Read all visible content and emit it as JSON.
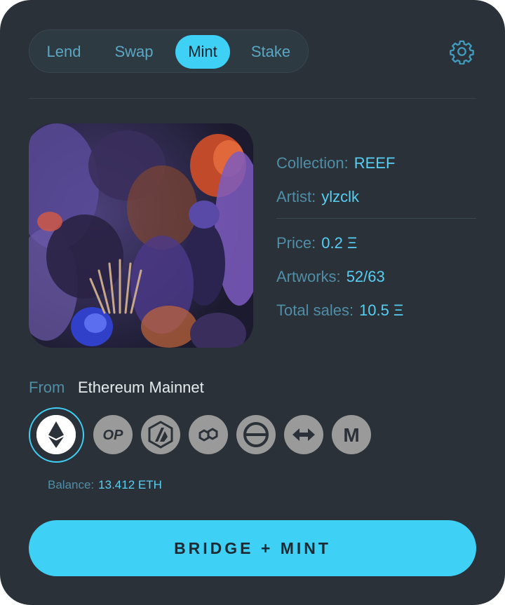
{
  "tabs": [
    {
      "label": "Lend",
      "active": false
    },
    {
      "label": "Swap",
      "active": false
    },
    {
      "label": "Mint",
      "active": true
    },
    {
      "label": "Stake",
      "active": false
    }
  ],
  "settings_icon": "gear-icon",
  "nft": {
    "collection_label": "Collection:",
    "collection_value": "REEF",
    "artist_label": "Artist:",
    "artist_value": "ylzclk",
    "price_label": "Price:",
    "price_value": "0.2 Ξ",
    "artworks_label": "Artworks:",
    "artworks_value": "52/63",
    "sales_label": "Total sales:",
    "sales_value": "10.5 Ξ"
  },
  "from": {
    "label": "From",
    "network": "Ethereum Mainnet"
  },
  "chains": [
    {
      "name": "ethereum-icon",
      "label": "",
      "selected": true
    },
    {
      "name": "optimism-icon",
      "label": "OP",
      "selected": false
    },
    {
      "name": "arbitrum-icon",
      "label": "",
      "selected": false
    },
    {
      "name": "polygon-icon",
      "label": "",
      "selected": false
    },
    {
      "name": "zksync-icon",
      "label": "",
      "selected": false
    },
    {
      "name": "bridge-arrows-icon",
      "label": "",
      "selected": false
    },
    {
      "name": "moonbeam-icon",
      "label": "M",
      "selected": false
    }
  ],
  "balance": {
    "label": "Balance:",
    "value": "13.412 ETH"
  },
  "cta": {
    "label": "BRIDGE + MINT"
  },
  "colors": {
    "background": "#2b3138",
    "accent": "#3fd0f6",
    "label": "#4f8ea6",
    "value": "#56cff3"
  }
}
